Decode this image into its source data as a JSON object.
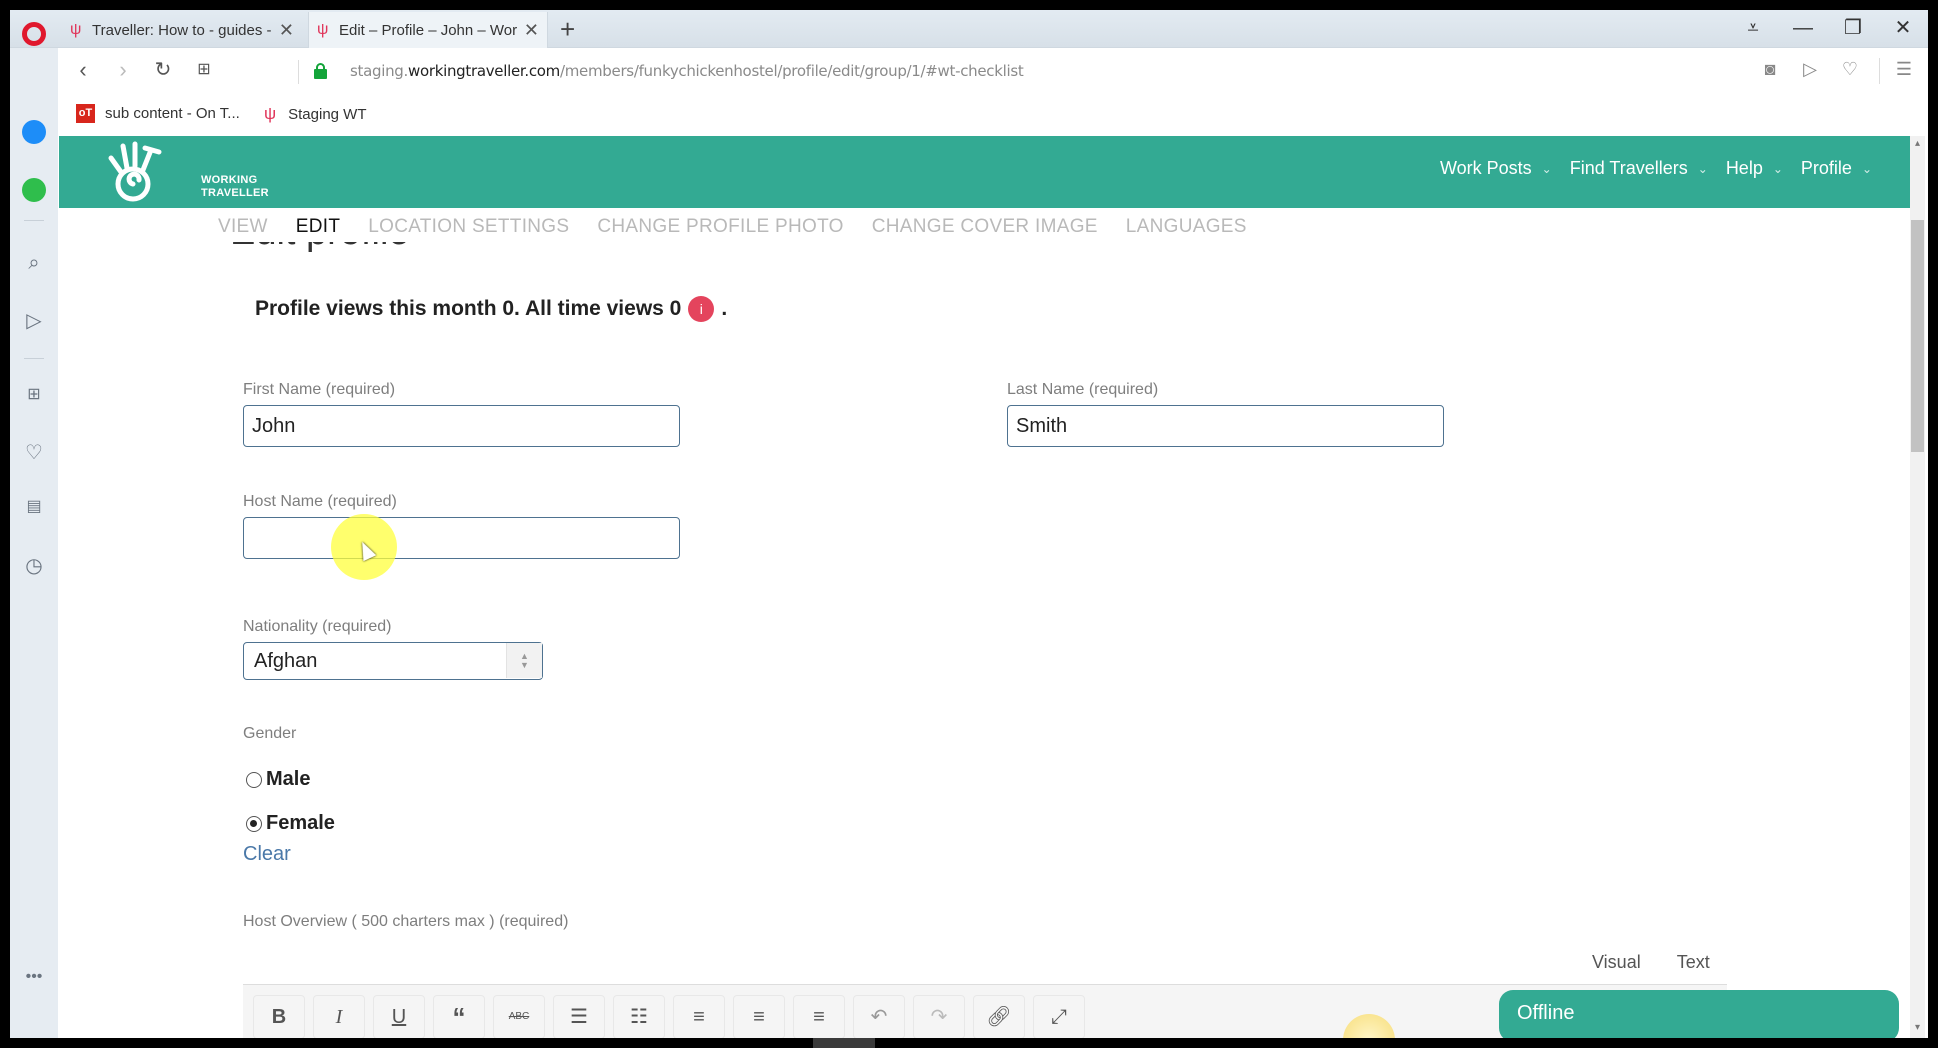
{
  "browser": {
    "tabs": [
      {
        "title": "Traveller: How to - guides -",
        "active": false
      },
      {
        "title": "Edit – Profile – John – Work",
        "active": true
      }
    ],
    "new_tab": "+",
    "url": {
      "prefix": "staging.",
      "host": "workingtraveller.com",
      "path": "/members/funkychickenhostel/profile/edit/group/1/#wt-checklist"
    },
    "bookmarks": [
      {
        "label": "sub content - On T...",
        "icon": "ot-icon"
      },
      {
        "label": "Staging WT",
        "icon": "wt-icon"
      }
    ],
    "window_controls": {
      "menu": "≡",
      "minimize": "—",
      "restore": "❐",
      "close": "✕"
    }
  },
  "site": {
    "logo_line1": "WORKING",
    "logo_line2": "TRAVELLER",
    "nav": [
      {
        "label": "Work Posts"
      },
      {
        "label": "Find Travellers"
      },
      {
        "label": "Help"
      },
      {
        "label": "Profile"
      }
    ],
    "subnav": [
      {
        "label": "VIEW",
        "active": false
      },
      {
        "label": "EDIT",
        "active": true
      },
      {
        "label": "LOCATION SETTINGS",
        "active": false
      },
      {
        "label": "CHANGE PROFILE PHOTO",
        "active": false
      },
      {
        "label": "CHANGE COVER IMAGE",
        "active": false
      },
      {
        "label": "LANGUAGES",
        "active": false
      }
    ]
  },
  "form": {
    "heading": "Edit profile",
    "views_text": "Profile views this month 0. All time views 0",
    "info_badge": "i",
    "views_suffix": ".",
    "first_name": {
      "label": "First Name (required)",
      "value": "John"
    },
    "last_name": {
      "label": "Last Name (required)",
      "value": "Smith"
    },
    "host_name": {
      "label": "Host Name (required)",
      "value": ""
    },
    "nationality": {
      "label": "Nationality (required)",
      "value": "Afghan"
    },
    "gender": {
      "label": "Gender",
      "options": [
        {
          "label": "Male",
          "checked": false
        },
        {
          "label": "Female",
          "checked": true
        }
      ],
      "clear": "Clear"
    },
    "host_overview": {
      "label": "Host Overview ( 500 charters max ) (required)",
      "tabs": [
        "Visual",
        "Text"
      ],
      "toolbar": [
        "bold",
        "italic",
        "underline",
        "blockquote",
        "strikethrough",
        "bullet-list",
        "numbered-list",
        "align-left",
        "align-center",
        "align-right",
        "undo",
        "redo",
        "link",
        "fullscreen"
      ]
    }
  },
  "chat": {
    "status": "Offline"
  },
  "colors": {
    "brand": "#33aa93",
    "badge": "#e4445d",
    "link": "#4a78a8"
  }
}
